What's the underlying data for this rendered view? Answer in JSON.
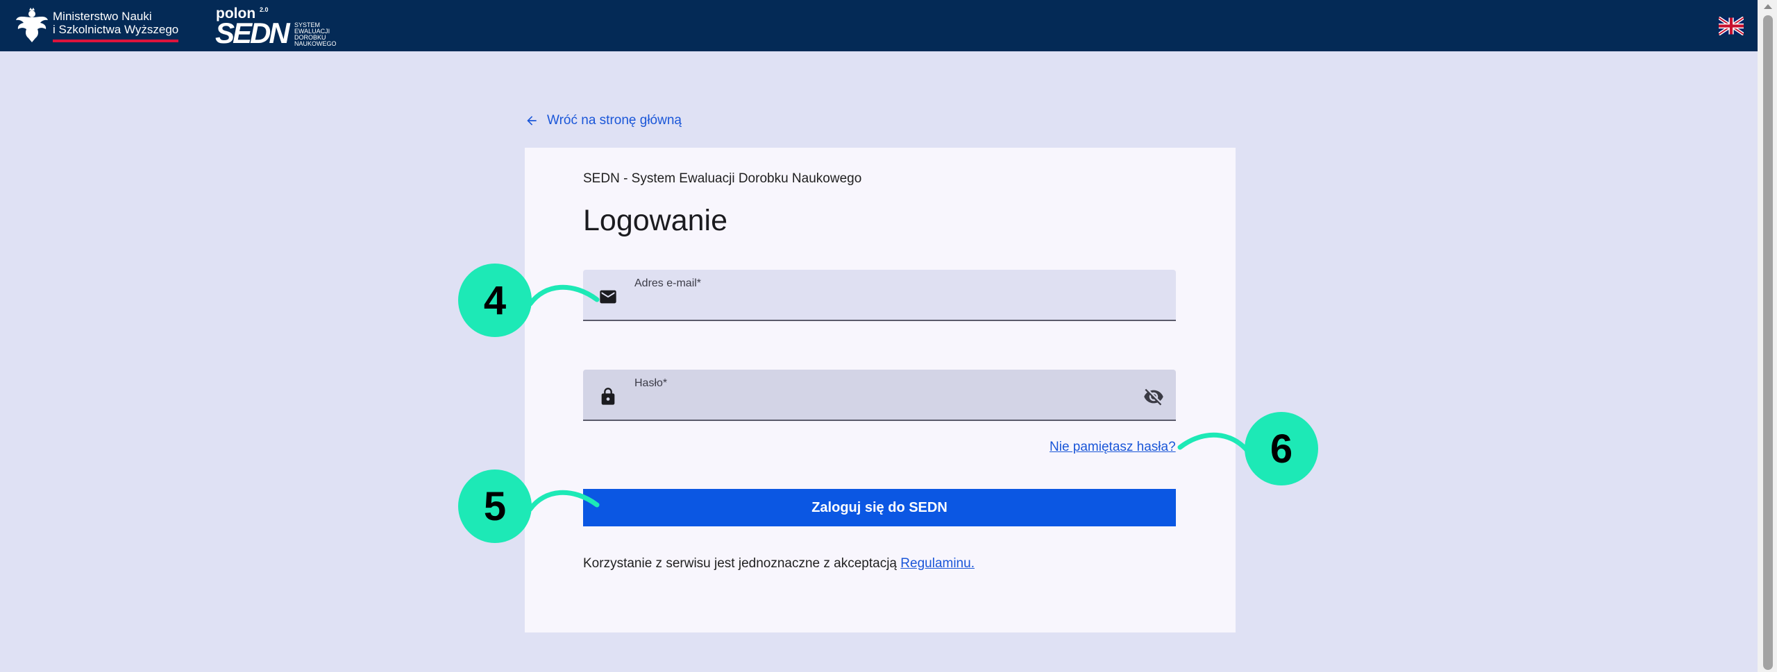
{
  "header": {
    "ministry_line1": "Ministerstwo Nauki",
    "ministry_line2": "i Szkolnictwa Wyższego",
    "polon_text": "polon",
    "polon_version": "2.0",
    "sedn_logo_text": "SEDN",
    "sedn_logo_sub": [
      "SYSTEM",
      "EWALUACJI",
      "DOROBKU",
      "NAUKOWEGO"
    ],
    "language_flag_icon": "uk-flag-icon",
    "bar_color": "#042a56"
  },
  "back_link": {
    "label": "Wróć na stronę główną",
    "icon": "arrow-left-icon"
  },
  "login_card": {
    "subtitle": "SEDN - System Ewaluacji Dorobku Naukowego",
    "title": "Logowanie",
    "email_field": {
      "label": "Adres e-mail*",
      "value": "",
      "icon": "envelope-icon"
    },
    "password_field": {
      "label": "Hasło*",
      "value": "",
      "icon": "lock-icon",
      "toggle_icon": "eye-off-icon"
    },
    "forgot_password_label": "Nie pamiętasz hasła?",
    "submit_label": "Zaloguj się do SEDN",
    "terms_text": "Korzystanie z serwisu jest jednoznaczne z akceptacją",
    "terms_link": "Regulaminu."
  },
  "annotations": {
    "callout_email": "4",
    "callout_submit": "5",
    "callout_forgot": "6",
    "color": "#1de9b6"
  },
  "colors": {
    "background": "#dfe1f4",
    "card": "#f8f6fd",
    "primary_button": "#0b57e3",
    "link": "#1a56d8"
  }
}
